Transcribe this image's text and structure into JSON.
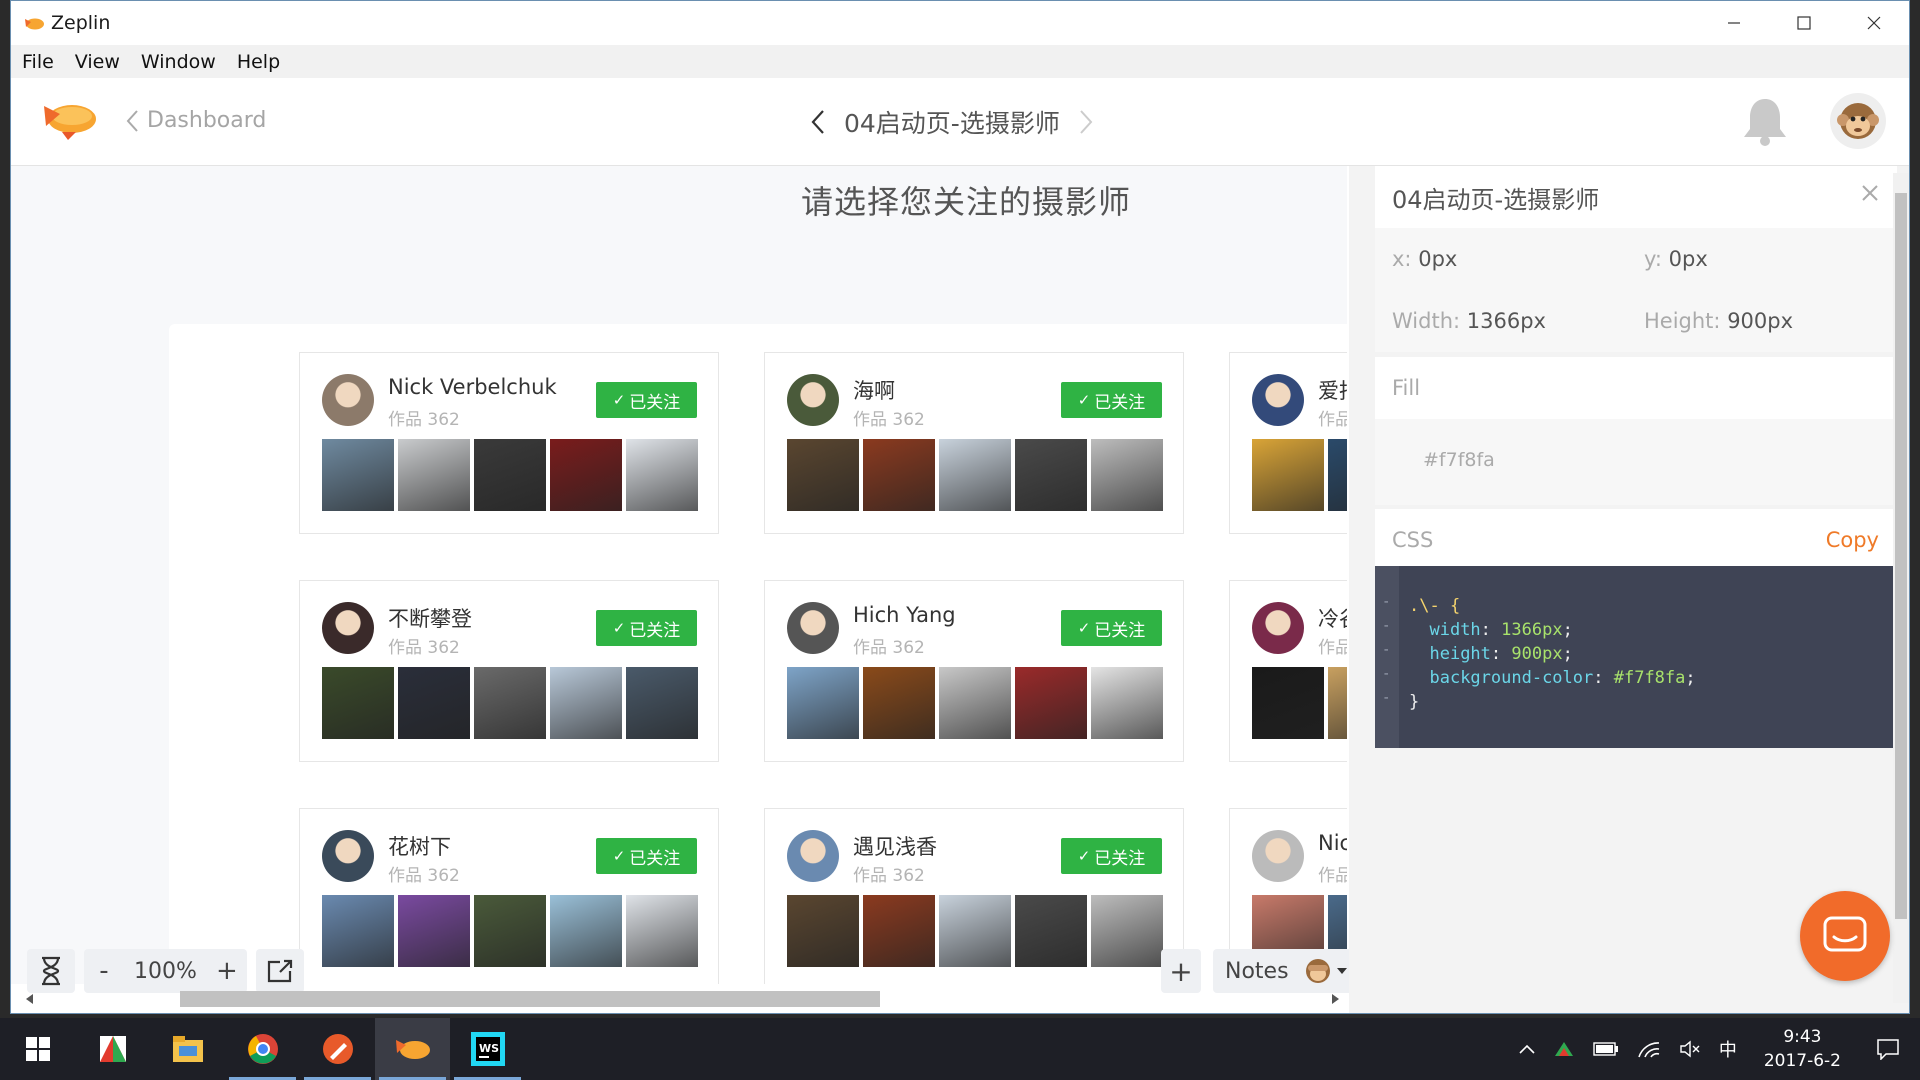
{
  "window": {
    "app_title": "Zeplin",
    "menu": [
      "File",
      "View",
      "Window",
      "Help"
    ]
  },
  "toolbar": {
    "back_label": "Dashboard",
    "screen_title": "04启动页-选摄影师"
  },
  "canvas": {
    "page_title": "请选择您关注的摄影师",
    "follow_label": "已关注",
    "cards": [
      {
        "name": "Nick Verbelchuk",
        "count": "作品 362",
        "photos": [
          "#6f8aa0",
          "#c9cbcd",
          "#3a3a3a",
          "#7a1c1c",
          "#dfe3e8"
        ],
        "avatar": "#8c7a6a"
      },
      {
        "name": "海啊",
        "count": "作品 362",
        "photos": [
          "#5a4630",
          "#8b3a1f",
          "#c8d2dc",
          "#4a4a4a",
          "#bdbdbd"
        ],
        "avatar": "#4a5a3a"
      },
      {
        "name": "爱拍",
        "count": "作品",
        "photos": [
          "#d9a437",
          "#2a4a6a"
        ],
        "avatar": "#334a7a"
      },
      {
        "name": "不断攀登",
        "count": "作品 362",
        "photos": [
          "#3a4a2a",
          "#2a2e3a",
          "#6a6a6a",
          "#b8c8d8",
          "#4a5a6a"
        ],
        "avatar": "#3a2a2a"
      },
      {
        "name": "Hich Yang",
        "count": "作品 362",
        "photos": [
          "#7ea4c8",
          "#8a4a1a",
          "#c8c8c8",
          "#9a2a2a",
          "#e4e4e4"
        ],
        "avatar": "#555"
      },
      {
        "name": "冷谷",
        "count": "作品",
        "photos": [
          "#1a1a1a",
          "#c8a060"
        ],
        "avatar": "#7a2a4a"
      },
      {
        "name": "花树下",
        "count": "作品 362",
        "photos": [
          "#6a8ab0",
          "#7a4aa0",
          "#4a5a3a",
          "#9ac0d8",
          "#dfe3e8"
        ],
        "avatar": "#3a4a5a"
      },
      {
        "name": "遇见浅香",
        "count": "作品 362",
        "photos": [
          "#5a4630",
          "#8b3a1f",
          "#c8d2dc",
          "#4a4a4a",
          "#bdbdbd"
        ],
        "avatar": "#6a8ab0"
      },
      {
        "name": "Nic",
        "count": "作品",
        "photos": [
          "#c87a6a",
          "#4a6a8a"
        ],
        "avatar": "#bbb"
      }
    ],
    "zoom": "100%",
    "notes_label": "Notes"
  },
  "inspector": {
    "title": "04启动页-选摄影师",
    "x_label": "x:",
    "x_value": "0px",
    "y_label": "y:",
    "y_value": "0px",
    "w_label": "Width:",
    "w_value": "1366px",
    "h_label": "Height:",
    "h_value": "900px",
    "fill_label": "Fill",
    "fill_value": "#f7f8fa",
    "css_label": "CSS",
    "copy_label": "Copy",
    "css_selector": ".\\- {",
    "css_lines": [
      {
        "prop": "width",
        "val": "1366px"
      },
      {
        "prop": "height",
        "val": "900px"
      },
      {
        "prop": "background-color",
        "val": "#f7f8fa"
      }
    ],
    "css_close": "}"
  },
  "taskbar": {
    "time": "9:43",
    "date": "2017-6-2",
    "ime": "中"
  },
  "colors": {
    "accent_green": "#2fb344",
    "accent_orange": "#ef7a28",
    "canvas_bg": "#f7f8fa",
    "code_bg": "#3f4455"
  }
}
